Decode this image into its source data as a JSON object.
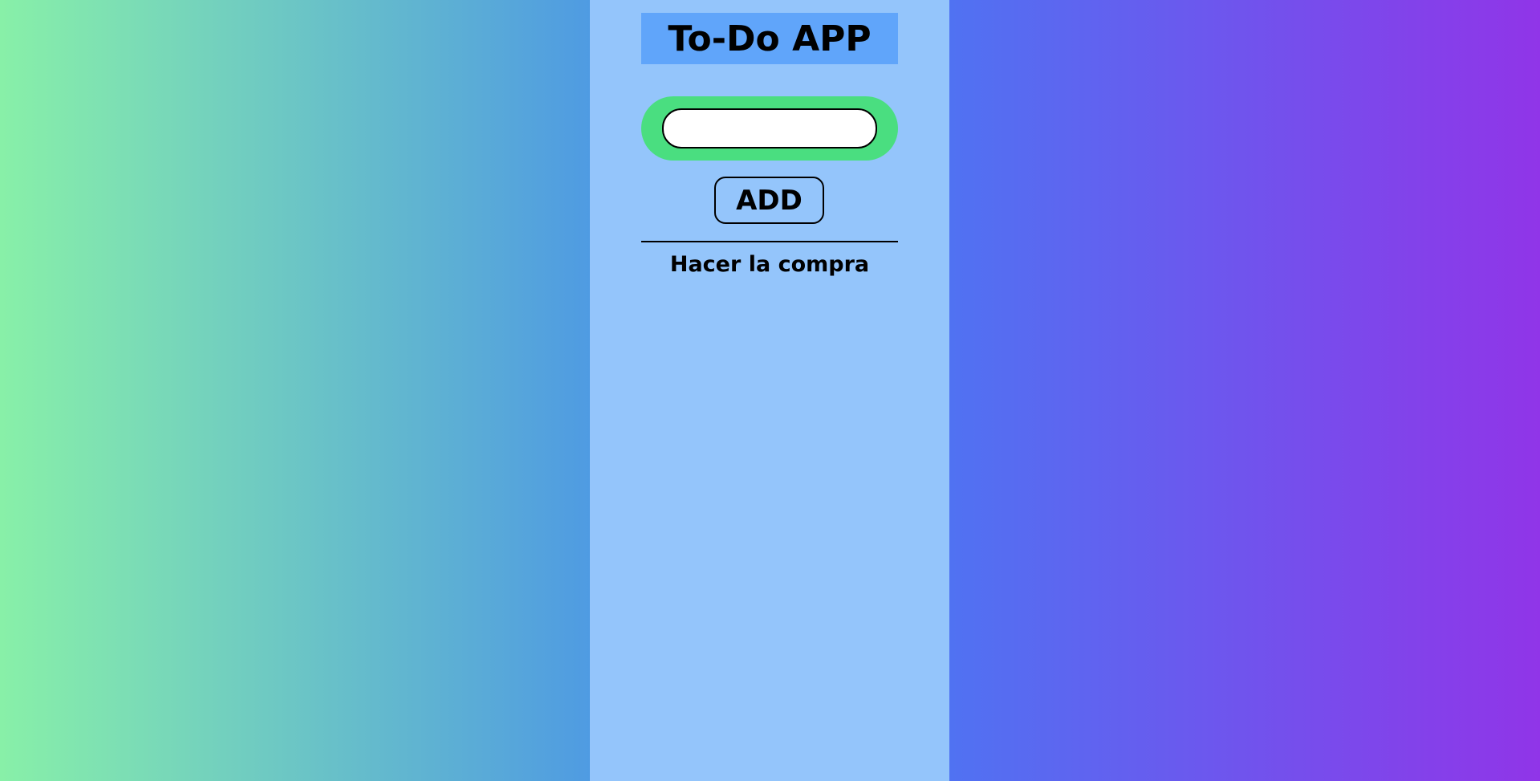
{
  "app": {
    "title": "To-Do APP",
    "input": {
      "value": "",
      "placeholder": ""
    },
    "add_label": "ADD",
    "tasks": [
      {
        "label": "Hacer la compra"
      }
    ]
  },
  "colors": {
    "panel": "#94c5fb",
    "title_bg": "#60a5fa",
    "input_frame": "#4ade80",
    "left_gradient": [
      "#88f0a8",
      "#4f9be2"
    ],
    "right_gradient": [
      "#5072f2",
      "#9035e8"
    ]
  }
}
